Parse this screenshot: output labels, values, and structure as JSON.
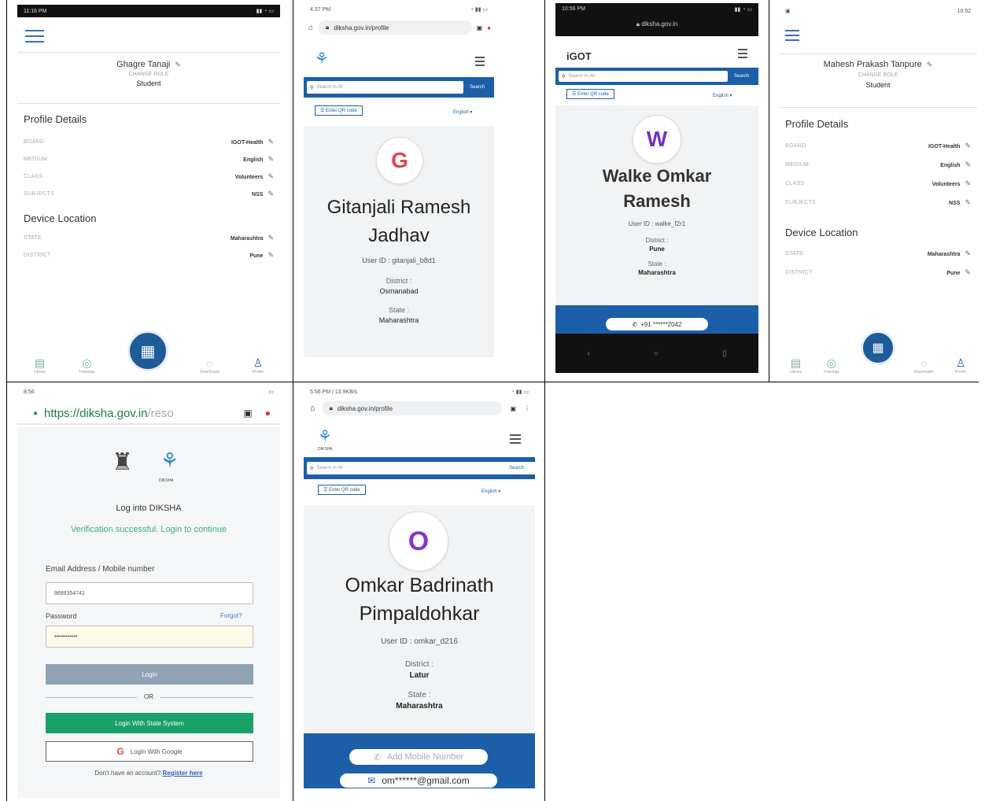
{
  "p1": {
    "status": "11:16 PM",
    "name": "Ghagre Tanaji",
    "change_role": "CHANGE ROLE",
    "role": "Student",
    "profile_title": "Profile Details",
    "rows": [
      {
        "k": "BOARD",
        "v": "IGOT-Health"
      },
      {
        "k": "MEDIUM",
        "v": "English"
      },
      {
        "k": "CLASS",
        "v": "Volunteers"
      },
      {
        "k": "SUBJECTS",
        "v": "NSS"
      }
    ],
    "loc_title": "Device Location",
    "loc_rows": [
      {
        "k": "STATE",
        "v": "Maharashtra"
      },
      {
        "k": "DISTRICT",
        "v": "Pune"
      }
    ],
    "nav": [
      "Library",
      "Trainings",
      "Downloads",
      "Profile"
    ]
  },
  "p2": {
    "status": "4:37 PM",
    "url": "diksha.gov.in/profile",
    "search_placeholder": "Search in All",
    "search_btn": "Search",
    "qr": "Enter QR code",
    "lang": "English",
    "initial": "G",
    "name": "Gitanjali Ramesh Jadhav",
    "user_id": "User ID : gitanjali_b8d1",
    "district_label": "District :",
    "district": "Osmanabad",
    "state_label": "State :",
    "state": "Maharashtra"
  },
  "p3": {
    "status": "10:56 PM",
    "url": "diksha.gov.in",
    "brand": "iGOT",
    "search_placeholder": "Search in All",
    "search_btn": "Search",
    "qr": "Enter QR code",
    "lang": "English",
    "initial": "W",
    "name": "Walke Omkar Ramesh",
    "user_id": "User ID : walke_f2r1",
    "district_label": "District :",
    "district": "Pune",
    "state_label": "State :",
    "state": "Maharashtra",
    "phone": "+91 ******2042"
  },
  "p4": {
    "status": "10:52",
    "name": "Mahesh Prakash Tanpure",
    "change_role": "CHANGE ROLE",
    "role": "Student",
    "profile_title": "Profile Details",
    "rows": [
      {
        "k": "BOARD",
        "v": "IGOT-Health"
      },
      {
        "k": "MEDIUM",
        "v": "English"
      },
      {
        "k": "CLASS",
        "v": "Volunteers"
      },
      {
        "k": "SUBJECTS",
        "v": "NSS"
      }
    ],
    "loc_title": "Device Location",
    "loc_rows": [
      {
        "k": "STATE",
        "v": "Maharashtra"
      },
      {
        "k": "DISTRICT",
        "v": "Pune"
      }
    ],
    "nav": [
      "Library",
      "Trainings",
      "Downloads",
      "Profile"
    ]
  },
  "p5": {
    "status": "8:56",
    "url_main": "https://diksha.gov.in",
    "url_rest": "/reso",
    "logo_text": "DIKSHA",
    "title": "Log into DIKSHA",
    "verify": "Verification successful. Login to continue",
    "email_label": "Email Address / Mobile number",
    "email_value": "9689354741",
    "password_label": "Password",
    "forgot": "Forgot?",
    "password_value": "••••••••••••",
    "login": "Login",
    "or": "OR",
    "state_login": "Login With State System",
    "google_login": "Login With Google",
    "no_account": "Don't have an account?",
    "register": "Register here"
  },
  "p6": {
    "status": "5:56 PM | 13.9KB/s",
    "url": "diksha.gov.in/profile",
    "logo_text": "DIKSHA",
    "search_placeholder": "Search in All",
    "search_btn": "Search",
    "qr": "Enter QR code",
    "lang": "English",
    "initial": "O",
    "name": "Omkar Badrinath Pimpaldohkar",
    "user_id": "User ID : omkar_d216",
    "district_label": "District :",
    "district": "Latur",
    "state_label": "State :",
    "state": "Maharashtra",
    "add_mobile": "Add Mobile Number",
    "email": "om******@gmail.com"
  }
}
